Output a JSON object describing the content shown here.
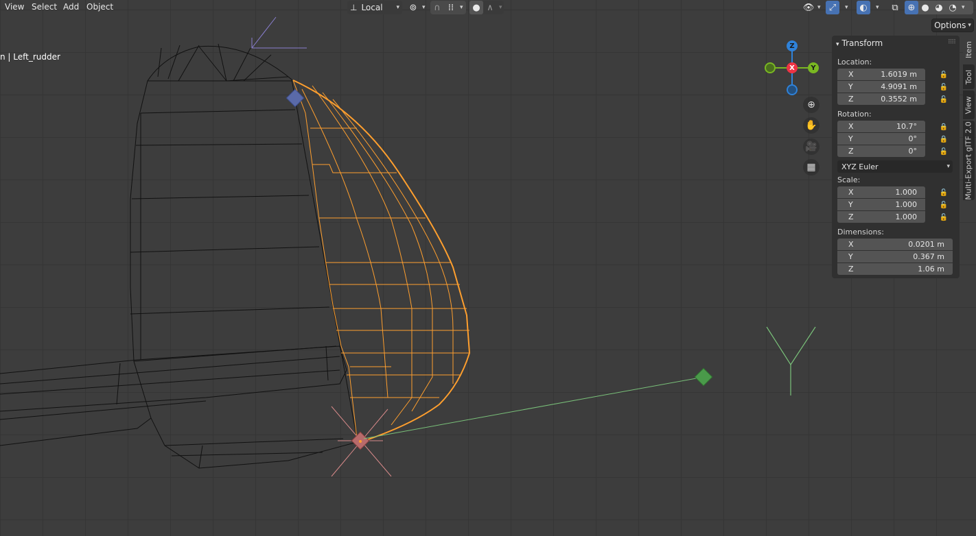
{
  "header": {
    "menus": [
      "View",
      "Select",
      "Add",
      "Object"
    ],
    "transform_orientation": "Local",
    "options_label": "Options"
  },
  "viewport": {
    "object_label": "n | Left_rudder"
  },
  "gizmo": {
    "z_label": "Z",
    "x_label": "X",
    "y_label": "Y"
  },
  "nav_icons": [
    "zoom-icon",
    "hand-icon",
    "camera-icon",
    "grid-icon"
  ],
  "npanel": {
    "title": "Transform",
    "location": {
      "label": "Location:",
      "x": {
        "axis": "X",
        "value": "1.6019 m"
      },
      "y": {
        "axis": "Y",
        "value": "4.9091 m"
      },
      "z": {
        "axis": "Z",
        "value": "0.3552 m"
      }
    },
    "rotation": {
      "label": "Rotation:",
      "x": {
        "axis": "X",
        "value": "10.7°"
      },
      "y": {
        "axis": "Y",
        "value": "0°"
      },
      "z": {
        "axis": "Z",
        "value": "0°"
      },
      "mode": "XYZ Euler"
    },
    "scale": {
      "label": "Scale:",
      "x": {
        "axis": "X",
        "value": "1.000"
      },
      "y": {
        "axis": "Y",
        "value": "1.000"
      },
      "z": {
        "axis": "Z",
        "value": "1.000"
      }
    },
    "dimensions": {
      "label": "Dimensions:",
      "x": {
        "axis": "X",
        "value": "0.0201 m"
      },
      "y": {
        "axis": "Y",
        "value": "0.367 m"
      },
      "z": {
        "axis": "Z",
        "value": "1.06 m"
      }
    }
  },
  "tabs": [
    "Item",
    "Tool",
    "View",
    "Multi-Export glTF 2.0"
  ],
  "colors": {
    "selection": "#ff9f2e",
    "wire": "#0d0d0d",
    "gizmo_x": "#ee3344",
    "gizmo_y": "#7ab822",
    "gizmo_z": "#2f82d9"
  }
}
